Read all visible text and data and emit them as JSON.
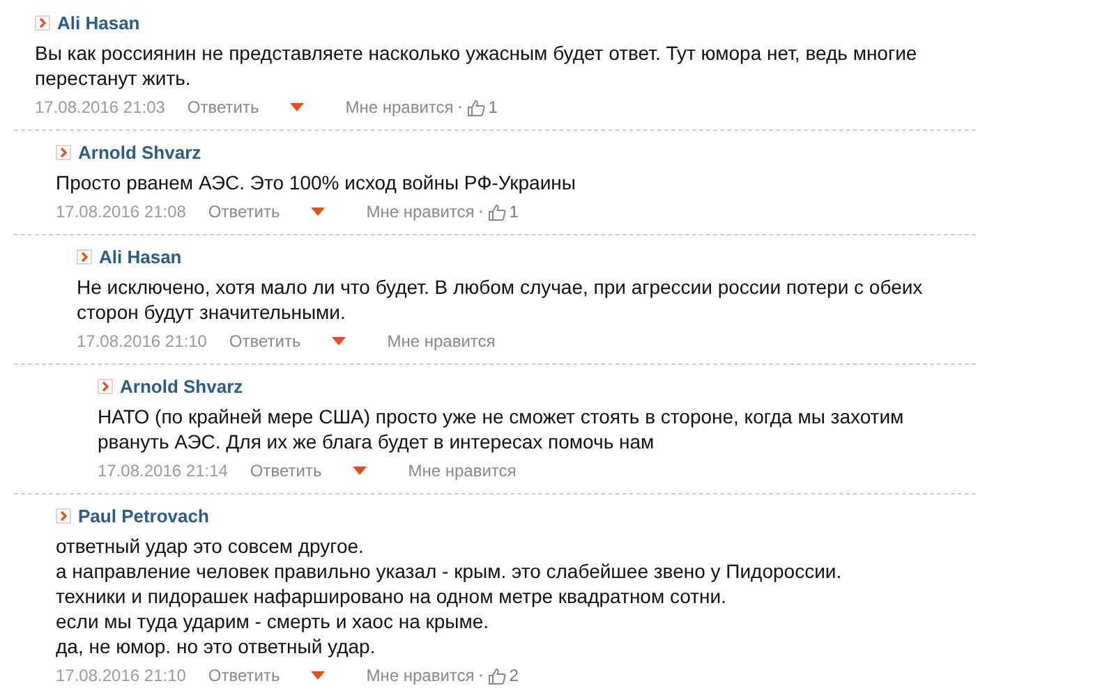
{
  "comments": [
    {
      "author": "Ali Hasan",
      "text": "Вы как россиянин не представляете насколько ужасным будет ответ. Тут юмора нет, ведь многие перестанут жить.",
      "date": "17.08.2016 21:03",
      "reply": "Ответить",
      "like": "Мне нравится",
      "likes": "1",
      "children": [
        {
          "author": "Arnold Shvarz",
          "text": "Просто рванем АЭС. Это 100% исход войны РФ-Украины",
          "date": "17.08.2016 21:08",
          "reply": "Ответить",
          "like": "Мне нравится",
          "likes": "1",
          "children": [
            {
              "author": "Ali Hasan",
              "text": "Не исключено, хотя мало ли что будет. В любом случае, при агрессии россии потери с обеих сторон будут значительными.",
              "date": "17.08.2016 21:10",
              "reply": "Ответить",
              "like": "Мне нравится",
              "children": [
                {
                  "author": "Arnold Shvarz",
                  "text": "НАТО (по крайней мере США) просто уже не сможет стоять в стороне, когда мы захотим рвануть АЭС. Для их же блага будет в интересах помочь нам",
                  "date": "17.08.2016 21:14",
                  "reply": "Ответить",
                  "like": "Мне нравится"
                }
              ]
            }
          ]
        },
        {
          "author": "Paul Petrovach",
          "text": "ответный удар это совсем другое.\nа направление человек правильно указал - крым. это слабейшее звено у Пидороссии.\nтехники и пидорашек нафаршировано на одном метре квадратном сотни.\nесли мы туда ударим - смерть и хаос на крыме.\nда, не юмор. но это ответный удар.",
          "date": "17.08.2016 21:10",
          "reply": "Ответить",
          "like": "Мне нравится",
          "likes": "2"
        }
      ]
    }
  ]
}
